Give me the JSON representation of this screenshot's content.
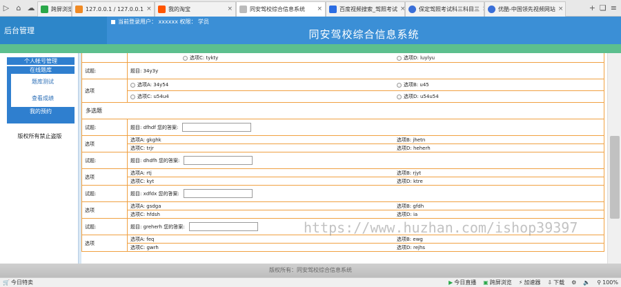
{
  "browser": {
    "tabs": [
      {
        "label": "跨屏浏览",
        "icon": "green-bookmark-icon",
        "color": "#2aa84a"
      },
      {
        "label": "127.0.0.1 / 127.0.0.1",
        "icon": "phpmyadmin-icon",
        "color": "#f08a24"
      },
      {
        "label": "我的淘宝",
        "icon": "taobao-icon",
        "color": "#ff5500"
      },
      {
        "label": "同安驾校综合信息系统",
        "icon": "page-icon",
        "color": "#888888"
      },
      {
        "label": "百度视频搜索_驾照考试",
        "icon": "baidu-video-icon",
        "color": "#2b6de3"
      },
      {
        "label": "保定驾照考试科三科目三",
        "icon": "play-icon",
        "color": "#3a6fd8"
      },
      {
        "label": "优酷-中国领先视频网站",
        "icon": "youku-icon",
        "color": "#3a6fd8"
      }
    ]
  },
  "header": {
    "left_title": "后台管理",
    "user_label": "当前登录用户： xxxxxx  权限： 学员",
    "title": "同安驾校综合信息系统"
  },
  "sidebar": {
    "items": [
      {
        "label": "个人帐号管理"
      },
      {
        "label": "在线题库"
      },
      {
        "label": "题库测试"
      },
      {
        "label": "查看成绩"
      },
      {
        "label": "我的预约"
      }
    ],
    "footer": "版权所有禁止盗版"
  },
  "content": {
    "top_row": {
      "opt_c": "选项C: tykty",
      "opt_d": "选项D: luylyu"
    },
    "single": {
      "question_label": "试题:",
      "question": "题目: 34y3y",
      "options_label": "选项",
      "opt_a": "选项A: 34y54",
      "opt_b": "选项B: u45",
      "opt_c": "选项C: u54u4",
      "opt_d": "选项D: u54u54"
    },
    "multi_section": "多选题",
    "multi": [
      {
        "question": "题目: dfhdf 您的答案:",
        "opt_a": "选项A: gkghk",
        "opt_b": "选项B: jhetn",
        "opt_c": "选项C: trjr",
        "opt_d": "选项D: heherh"
      },
      {
        "question": "题目: dhdfh 您的答案:",
        "opt_a": "选项A: rtj",
        "opt_b": "选项B: rjyt",
        "opt_c": "选项C: kyt",
        "opt_d": "选项D: ktre"
      },
      {
        "question": "题目: xdfdx 您的答案:",
        "opt_a": "选项A: gsdga",
        "opt_b": "选项B: gfdh",
        "opt_c": "选项C: hfdsh",
        "opt_d": "选项D: ia"
      },
      {
        "question": "题目: greherh 您的答案:",
        "opt_a": "选项A: feq",
        "opt_b": "选项B: ewg",
        "opt_c": "选项C: gwrh",
        "opt_d": "选项D: rejhs"
      }
    ],
    "question_label": "试题:",
    "options_label": "选项"
  },
  "footer": "版权所有：同安驾校综合信息系统",
  "statusbar": {
    "left": "今日特卖",
    "live": "今日直播",
    "cross": "跨屏浏览",
    "accel": "加速器",
    "download": "下载",
    "zoom": "100%"
  },
  "watermark": "https://www.huzhan.com/ishop39397"
}
